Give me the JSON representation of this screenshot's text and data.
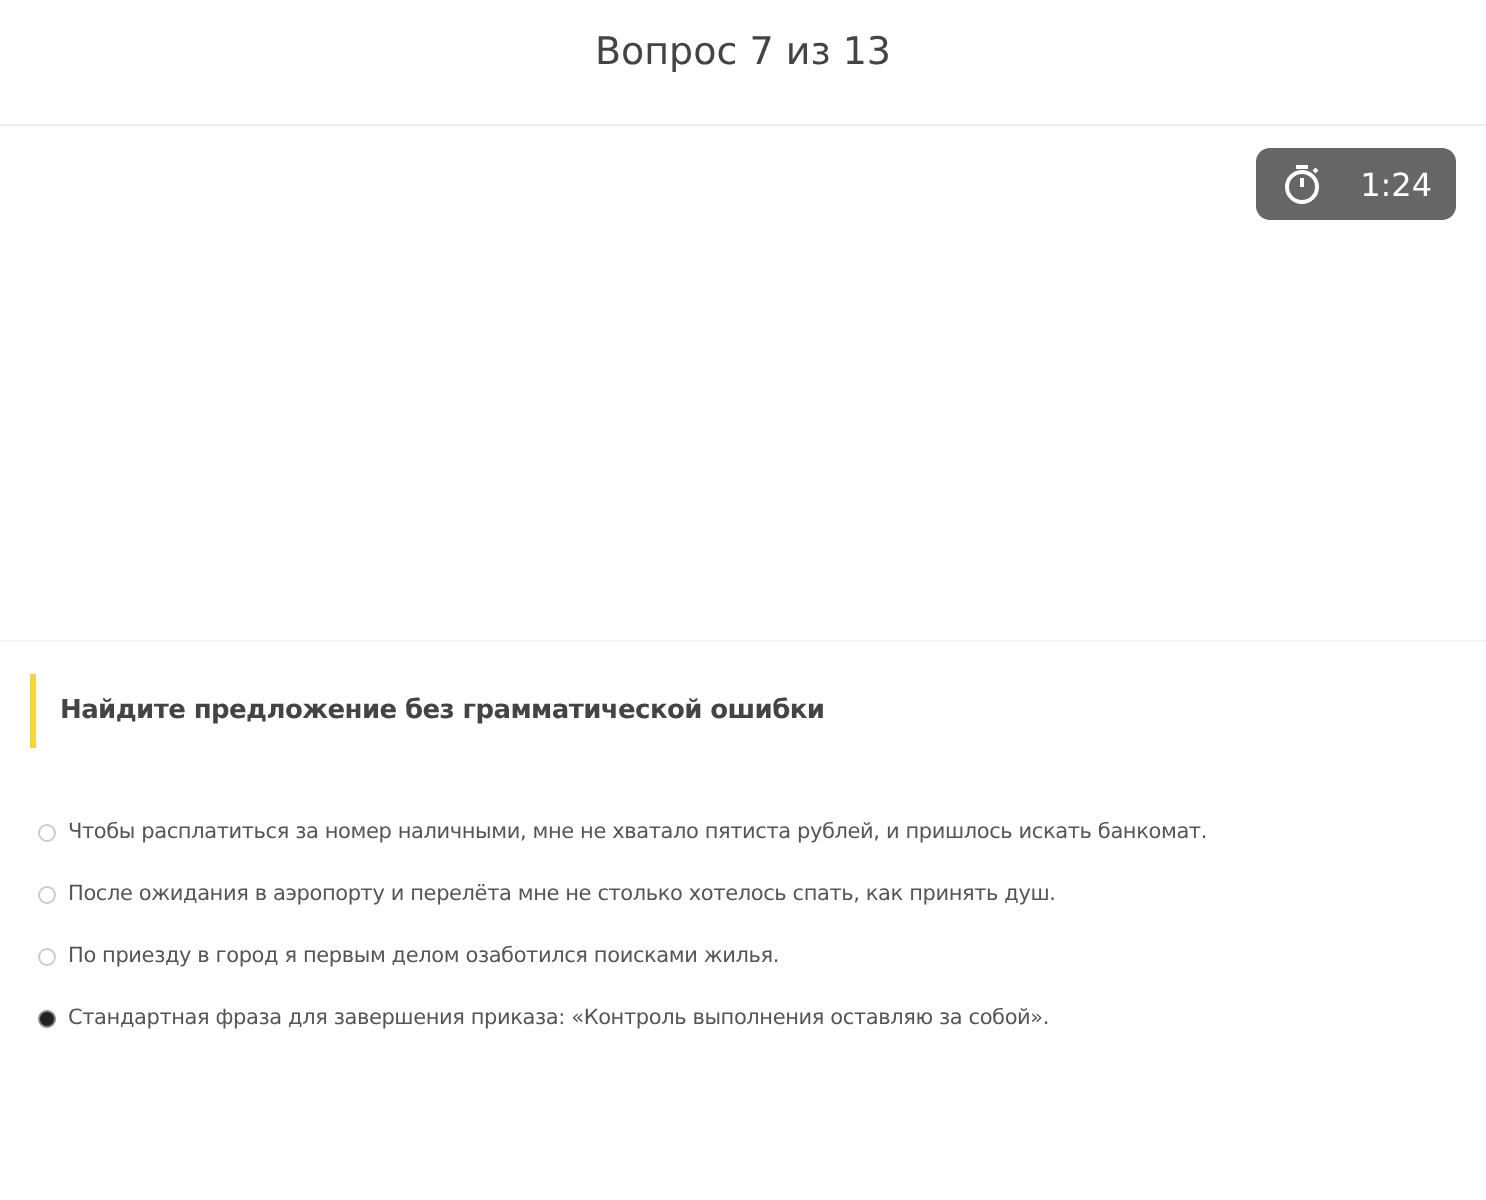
{
  "header": {
    "title": "Вопрос 7 из 13"
  },
  "timer": {
    "time": "1:24"
  },
  "question": {
    "prompt": "Найдите предложение без грамматической ошибки",
    "options": [
      {
        "text": "Чтобы расплатиться за номер наличными, мне не хватало пятиста рублей, и пришлось искать банкомат.",
        "selected": false
      },
      {
        "text": "После ожидания в аэропорту и перелёта мне не столько хотелось спать, как принять душ.",
        "selected": false
      },
      {
        "text": "По приезду в город я первым делом озаботился поисками жилья.",
        "selected": false
      },
      {
        "text": "Стандартная фраза для завершения приказа: «Контроль выполнения оставляю за собой».",
        "selected": true
      }
    ]
  }
}
